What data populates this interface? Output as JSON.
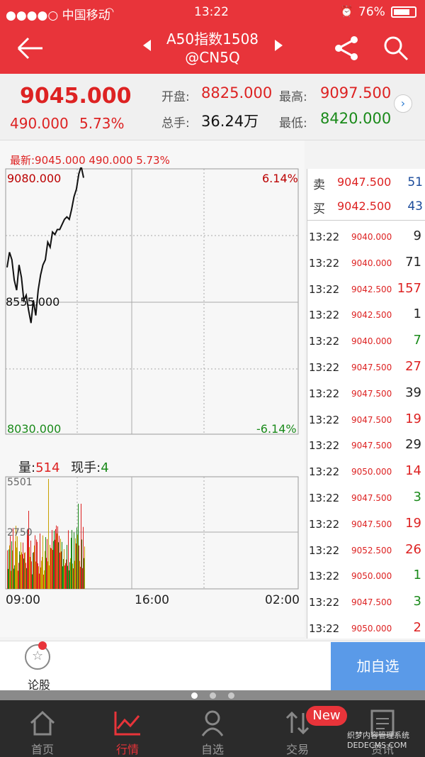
{
  "status": {
    "carrier": "●●●●○ 中国移动",
    "time": "13:22",
    "battery": "76%"
  },
  "nav": {
    "title_line1": "A50指数1508",
    "title_line2": "@CN5Q"
  },
  "quote": {
    "price": "9045.000",
    "change": "490.000",
    "change_pct": "5.73%",
    "open_label": "开盘:",
    "open": "8825.000",
    "high_label": "最高:",
    "high": "9097.500",
    "volume_label": "总手:",
    "volume": "36.24万",
    "low_label": "最低:",
    "low": "8420.000"
  },
  "chart": {
    "latest": "最新:9045.000 490.000 5.73%",
    "y_top": "9080.000",
    "y_mid": "8555.000",
    "y_bottom": "8030.000",
    "pct_top": "6.14%",
    "pct_bottom": "-6.14%",
    "vol_label": "量:",
    "vol_value": "514",
    "hand_label": "现手:",
    "hand_value": "4",
    "vol_top": "5501",
    "vol_mid": "2750",
    "x_labels": [
      "09:00",
      "16:00",
      "02:00"
    ]
  },
  "chart_data": {
    "type": "line",
    "title": "",
    "xlabel": "",
    "ylabel": "",
    "ylim": [
      8030,
      9080
    ],
    "price_series": [
      {
        "name": "",
        "values": [
          8690,
          8750,
          8720,
          8640,
          8600,
          8700,
          8650,
          8560,
          8580,
          8520,
          8470,
          8560,
          8500,
          8600,
          8660,
          8700,
          8720,
          8790,
          8770,
          8830,
          8820,
          8840,
          8840,
          8860,
          8880,
          8890,
          8880,
          8920,
          8970,
          9000,
          9060,
          9090,
          9045
        ]
      }
    ],
    "volume_ylim": [
      0,
      5501
    ]
  },
  "orderbook": {
    "sell_label": "卖",
    "sell_price": "9047.500",
    "sell_vol": "51",
    "buy_label": "买",
    "buy_price": "9042.500",
    "buy_vol": "43"
  },
  "colors": {
    "up": "#dd2222",
    "down": "#1a8a1a",
    "header": "#e8343a"
  },
  "ticks": [
    {
      "t": "13:22",
      "p": "9040.000",
      "v": "9",
      "c": "#222"
    },
    {
      "t": "13:22",
      "p": "9040.000",
      "v": "71",
      "c": "#222"
    },
    {
      "t": "13:22",
      "p": "9042.500",
      "v": "157",
      "c": "#d22"
    },
    {
      "t": "13:22",
      "p": "9042.500",
      "v": "1",
      "c": "#222"
    },
    {
      "t": "13:22",
      "p": "9040.000",
      "v": "7",
      "c": "#1a8a1a"
    },
    {
      "t": "13:22",
      "p": "9047.500",
      "v": "27",
      "c": "#d22"
    },
    {
      "t": "13:22",
      "p": "9047.500",
      "v": "39",
      "c": "#222"
    },
    {
      "t": "13:22",
      "p": "9047.500",
      "v": "19",
      "c": "#d22"
    },
    {
      "t": "13:22",
      "p": "9047.500",
      "v": "29",
      "c": "#222"
    },
    {
      "t": "13:22",
      "p": "9050.000",
      "v": "14",
      "c": "#d22"
    },
    {
      "t": "13:22",
      "p": "9047.500",
      "v": "3",
      "c": "#1a8a1a"
    },
    {
      "t": "13:22",
      "p": "9047.500",
      "v": "19",
      "c": "#d22"
    },
    {
      "t": "13:22",
      "p": "9052.500",
      "v": "26",
      "c": "#d22"
    },
    {
      "t": "13:22",
      "p": "9050.000",
      "v": "1",
      "c": "#1a8a1a"
    },
    {
      "t": "13:22",
      "p": "9047.500",
      "v": "3",
      "c": "#1a8a1a"
    },
    {
      "t": "13:22",
      "p": "9050.000",
      "v": "2",
      "c": "#d22"
    }
  ],
  "bottom": {
    "comment_label": "论股",
    "add_label": "加自选"
  },
  "tabs": [
    {
      "label": "首页",
      "icon": "home-icon"
    },
    {
      "label": "行情",
      "icon": "chart-icon"
    },
    {
      "label": "自选",
      "icon": "person-icon"
    },
    {
      "label": "交易",
      "icon": "trade-icon"
    },
    {
      "label": "资讯",
      "icon": "news-icon"
    }
  ],
  "new_badge": "New",
  "watermark": "织梦内容管理系统 DEDECMS.COM"
}
